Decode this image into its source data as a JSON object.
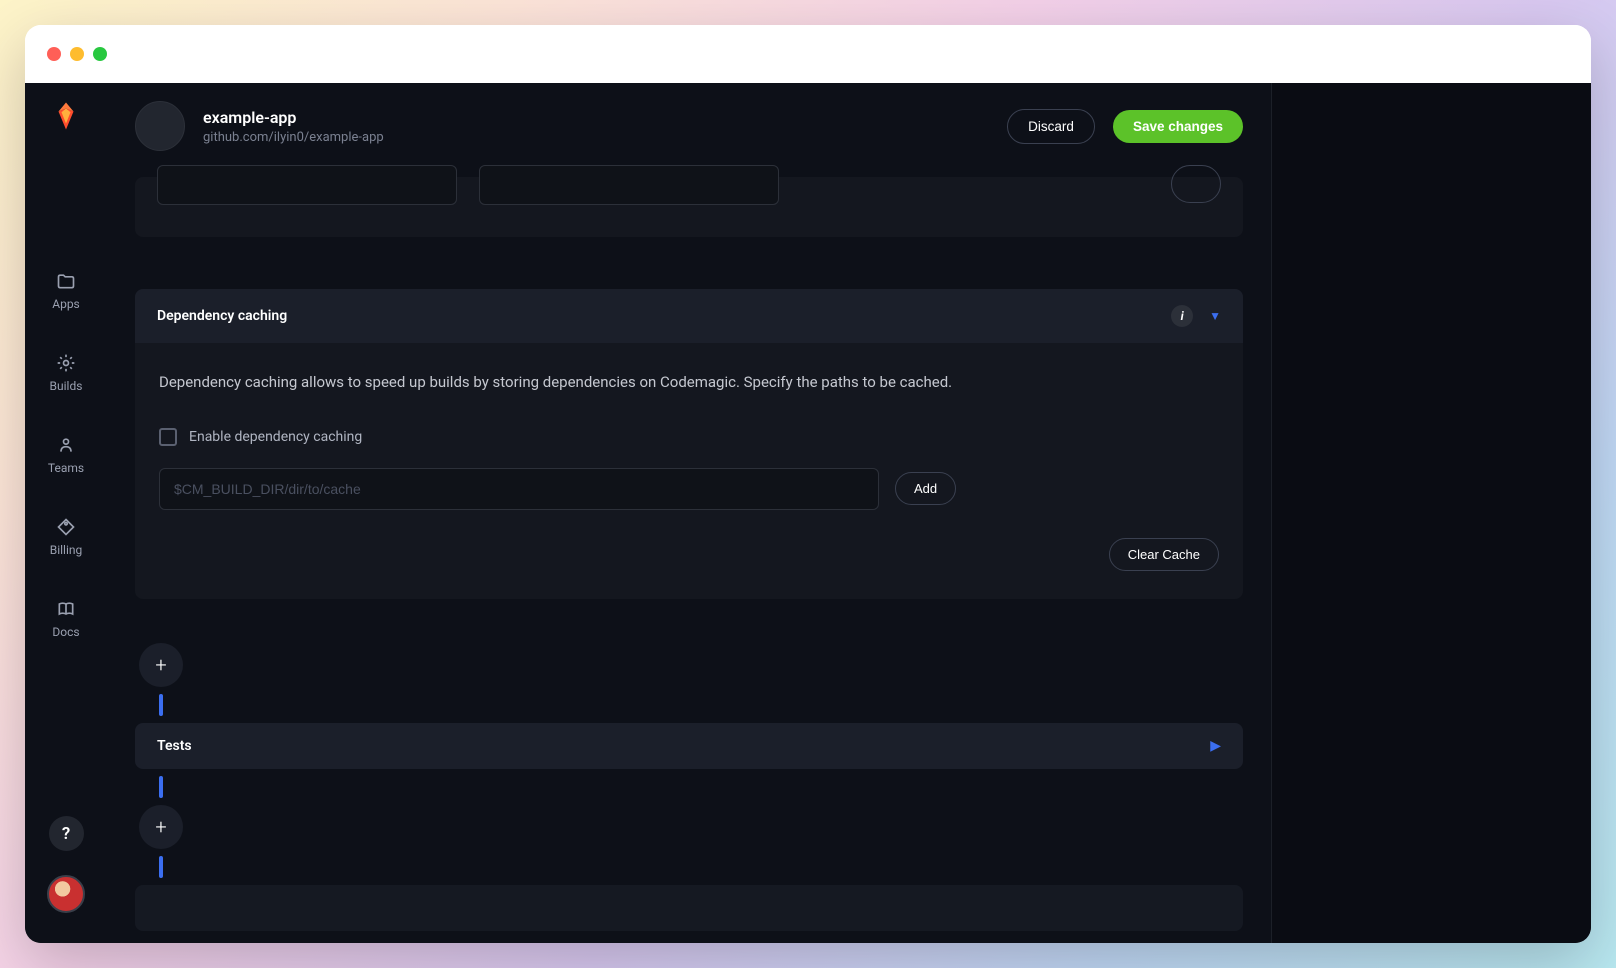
{
  "sidebar": {
    "items": [
      {
        "label": "Apps"
      },
      {
        "label": "Builds"
      },
      {
        "label": "Teams"
      },
      {
        "label": "Billing"
      },
      {
        "label": "Docs"
      }
    ],
    "help": "?"
  },
  "header": {
    "app_name": "example-app",
    "repo": "github.com/ilyin0/example-app",
    "discard_label": "Discard",
    "save_label": "Save changes"
  },
  "dependency_caching": {
    "title": "Dependency caching",
    "description": "Dependency caching allows to speed up builds by storing dependencies on Codemagic. Specify the paths to be cached.",
    "checkbox_label": "Enable dependency caching",
    "input_placeholder": "$CM_BUILD_DIR/dir/to/cache",
    "add_label": "Add",
    "clear_label": "Clear Cache"
  },
  "pipeline": {
    "tests_label": "Tests",
    "add_label": "+"
  }
}
